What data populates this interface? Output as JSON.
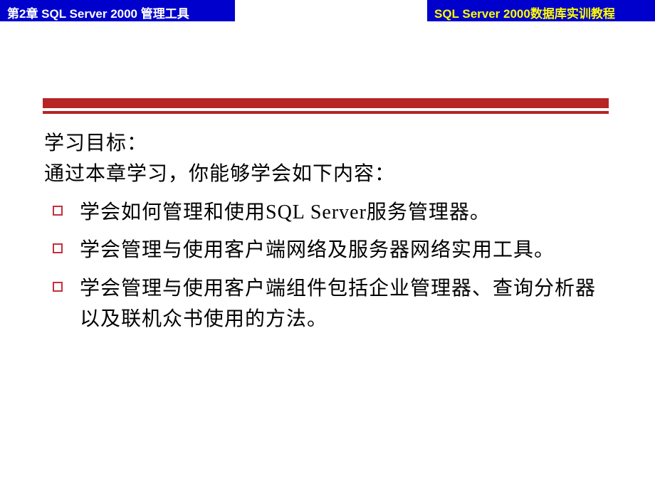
{
  "header": {
    "left": "第2章   SQL Server 2000  管理工具",
    "right": "SQL Server 2000数据库实训教程"
  },
  "content": {
    "title": "学习目标：",
    "intro": "通过本章学习，你能够学会如下内容：",
    "bullets": [
      "学会如何管理和使用SQL Server服务管理器。",
      "学会管理与使用客户端网络及服务器网络实用工具。",
      "学会管理与使用客户端组件包括企业管理器、查询分析器以及联机众书使用的方法。"
    ]
  }
}
